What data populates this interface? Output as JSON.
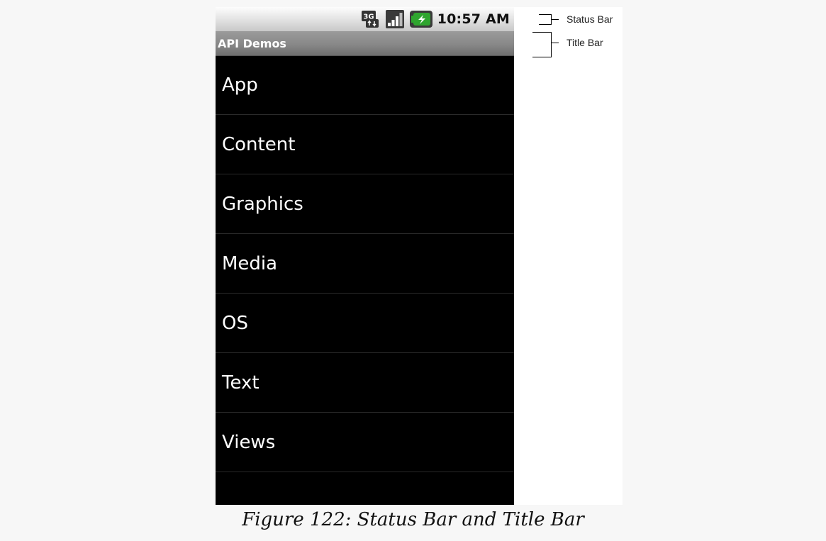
{
  "status_bar": {
    "network_icon": "3g-data-icon",
    "signal_icon": "signal-strength-icon",
    "battery_icon": "battery-charging-icon",
    "time": "10:57 AM"
  },
  "title_bar": {
    "title": "API Demos"
  },
  "list": {
    "items": [
      {
        "label": "App"
      },
      {
        "label": "Content"
      },
      {
        "label": "Graphics"
      },
      {
        "label": "Media"
      },
      {
        "label": "OS"
      },
      {
        "label": "Text"
      },
      {
        "label": "Views"
      }
    ]
  },
  "annotations": {
    "status_bar_label": "Status Bar",
    "title_bar_label": "Title Bar"
  },
  "caption": "Figure 122: Status Bar and Title Bar",
  "colors": {
    "list_background": "#000000",
    "list_text": "#ffffff",
    "title_bar_gray": "#8a8a8a",
    "status_bar_gray": "#e6e6e6",
    "battery_green": "#2fa52f"
  }
}
